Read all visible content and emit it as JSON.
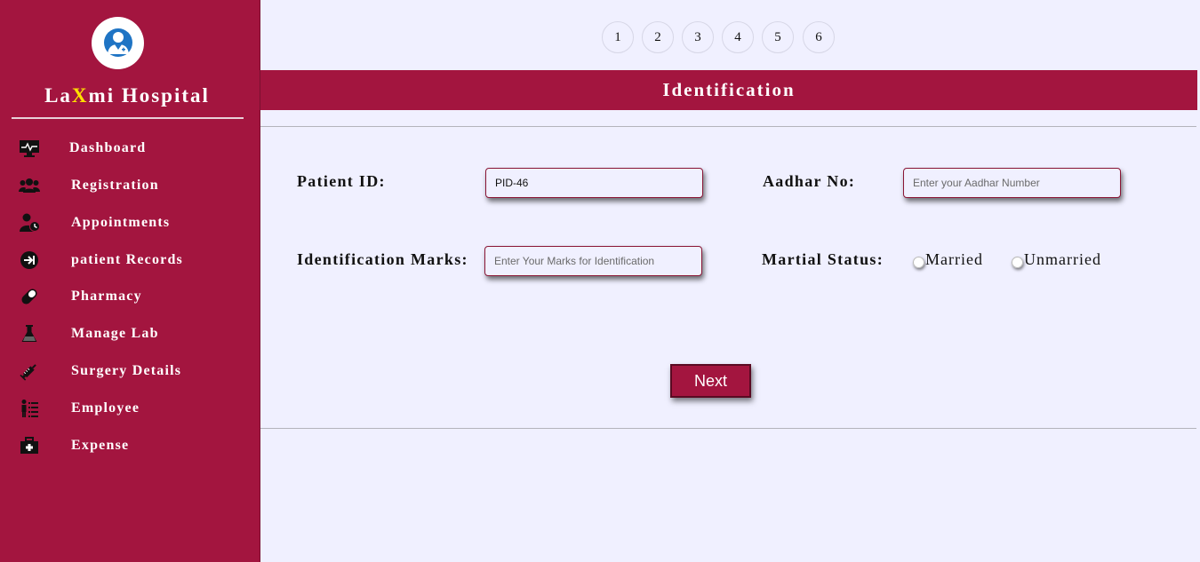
{
  "brand": {
    "prefix": "La",
    "highlight": "X",
    "suffix": "mi Hospital",
    "logo_icon": "doctor-icon"
  },
  "sidebar": {
    "items": [
      {
        "label": "Dashboard",
        "icon": "monitor-icon"
      },
      {
        "label": "Registration",
        "icon": "users-icon"
      },
      {
        "label": "Appointments",
        "icon": "user-clock-icon"
      },
      {
        "label": "patient Records",
        "icon": "sign-in-icon"
      },
      {
        "label": "Pharmacy",
        "icon": "pill-icon"
      },
      {
        "label": "Manage Lab",
        "icon": "flask-icon"
      },
      {
        "label": "Surgery Details",
        "icon": "syringe-icon"
      },
      {
        "label": "Employee",
        "icon": "employee-list-icon"
      },
      {
        "label": "Expense",
        "icon": "briefcase-medical-icon"
      }
    ]
  },
  "steps": [
    "1",
    "2",
    "3",
    "4",
    "5",
    "6"
  ],
  "section": {
    "title": "Identification"
  },
  "form": {
    "patient_id_label": "Patient ID:",
    "patient_id_value": "PID-46",
    "aadhar_label": "Aadhar No:",
    "aadhar_placeholder": "Enter your Aadhar Number",
    "marks_label": "Identification Marks:",
    "marks_placeholder": "Enter Your Marks for Identification",
    "marital_label": "Martial Status:",
    "marital_options": [
      "Married",
      "Unmarried"
    ],
    "next_label": "Next"
  },
  "colors": {
    "primary": "#a3153f",
    "background": "#f0f0ff",
    "highlight": "#ffe000"
  }
}
